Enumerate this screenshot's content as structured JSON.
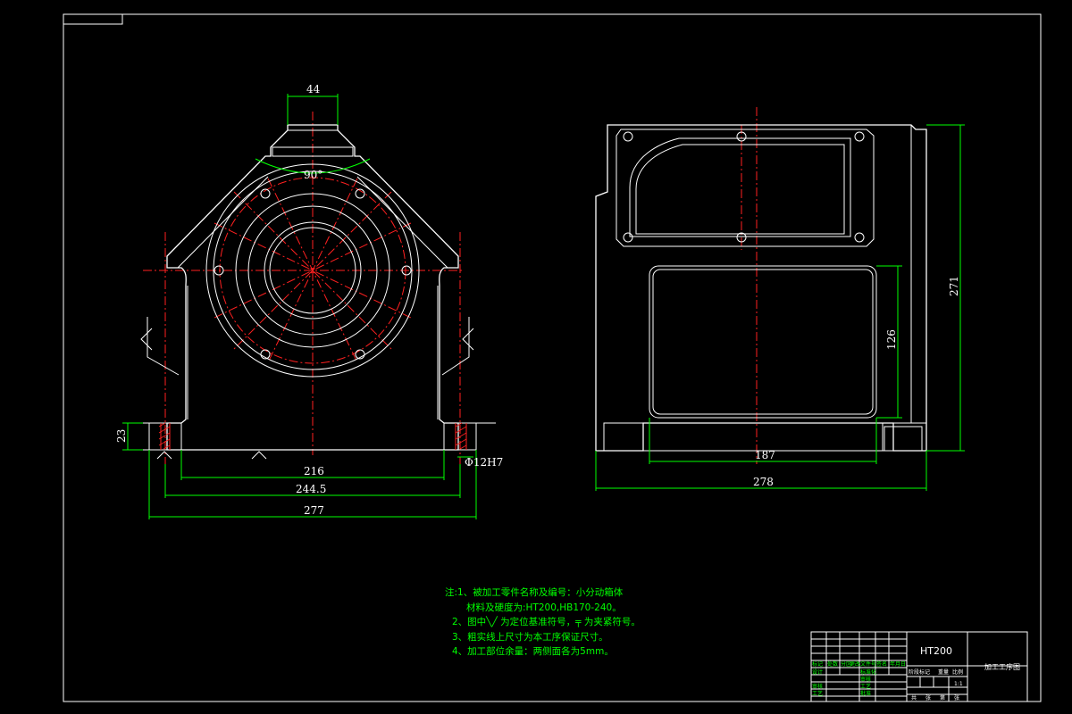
{
  "front_view": {
    "dims": {
      "top_width": "44",
      "angle": "90°",
      "base_height": "23",
      "span_inner": "216",
      "span_mid": "244.5",
      "span_overall": "277",
      "hole_fit": "Φ12H7"
    }
  },
  "side_view": {
    "dims": {
      "height": "271",
      "window_height": "126",
      "window_width": "187",
      "overall_width": "278"
    }
  },
  "notes": [
    "注:1、被加工零件名称及编号：小分动箱体",
    "材料及硬度为:HT200,HB170-240。",
    "2、图中╲╱ 为定位基准符号，╤ 为夹紧符号。",
    "3、粗实线上尺寸为本工序保证尺寸。",
    "4、加工部位余量：两侧面各为5mm。"
  ],
  "title_block": {
    "material": "HT200",
    "drawing_name": "加工工序图",
    "scale": "1:1",
    "row_labels": [
      "设计",
      "审核",
      "工艺"
    ],
    "header_cells": [
      "标记",
      "处数",
      "分区",
      "更改文件号",
      "签名",
      "年月日"
    ],
    "right_headers": [
      "阶段标记",
      "重量",
      "比例"
    ],
    "sheet": [
      "共",
      "张",
      "第",
      "张"
    ],
    "sign_labels": [
      "标准化",
      "审核",
      "工艺",
      "批准"
    ]
  }
}
